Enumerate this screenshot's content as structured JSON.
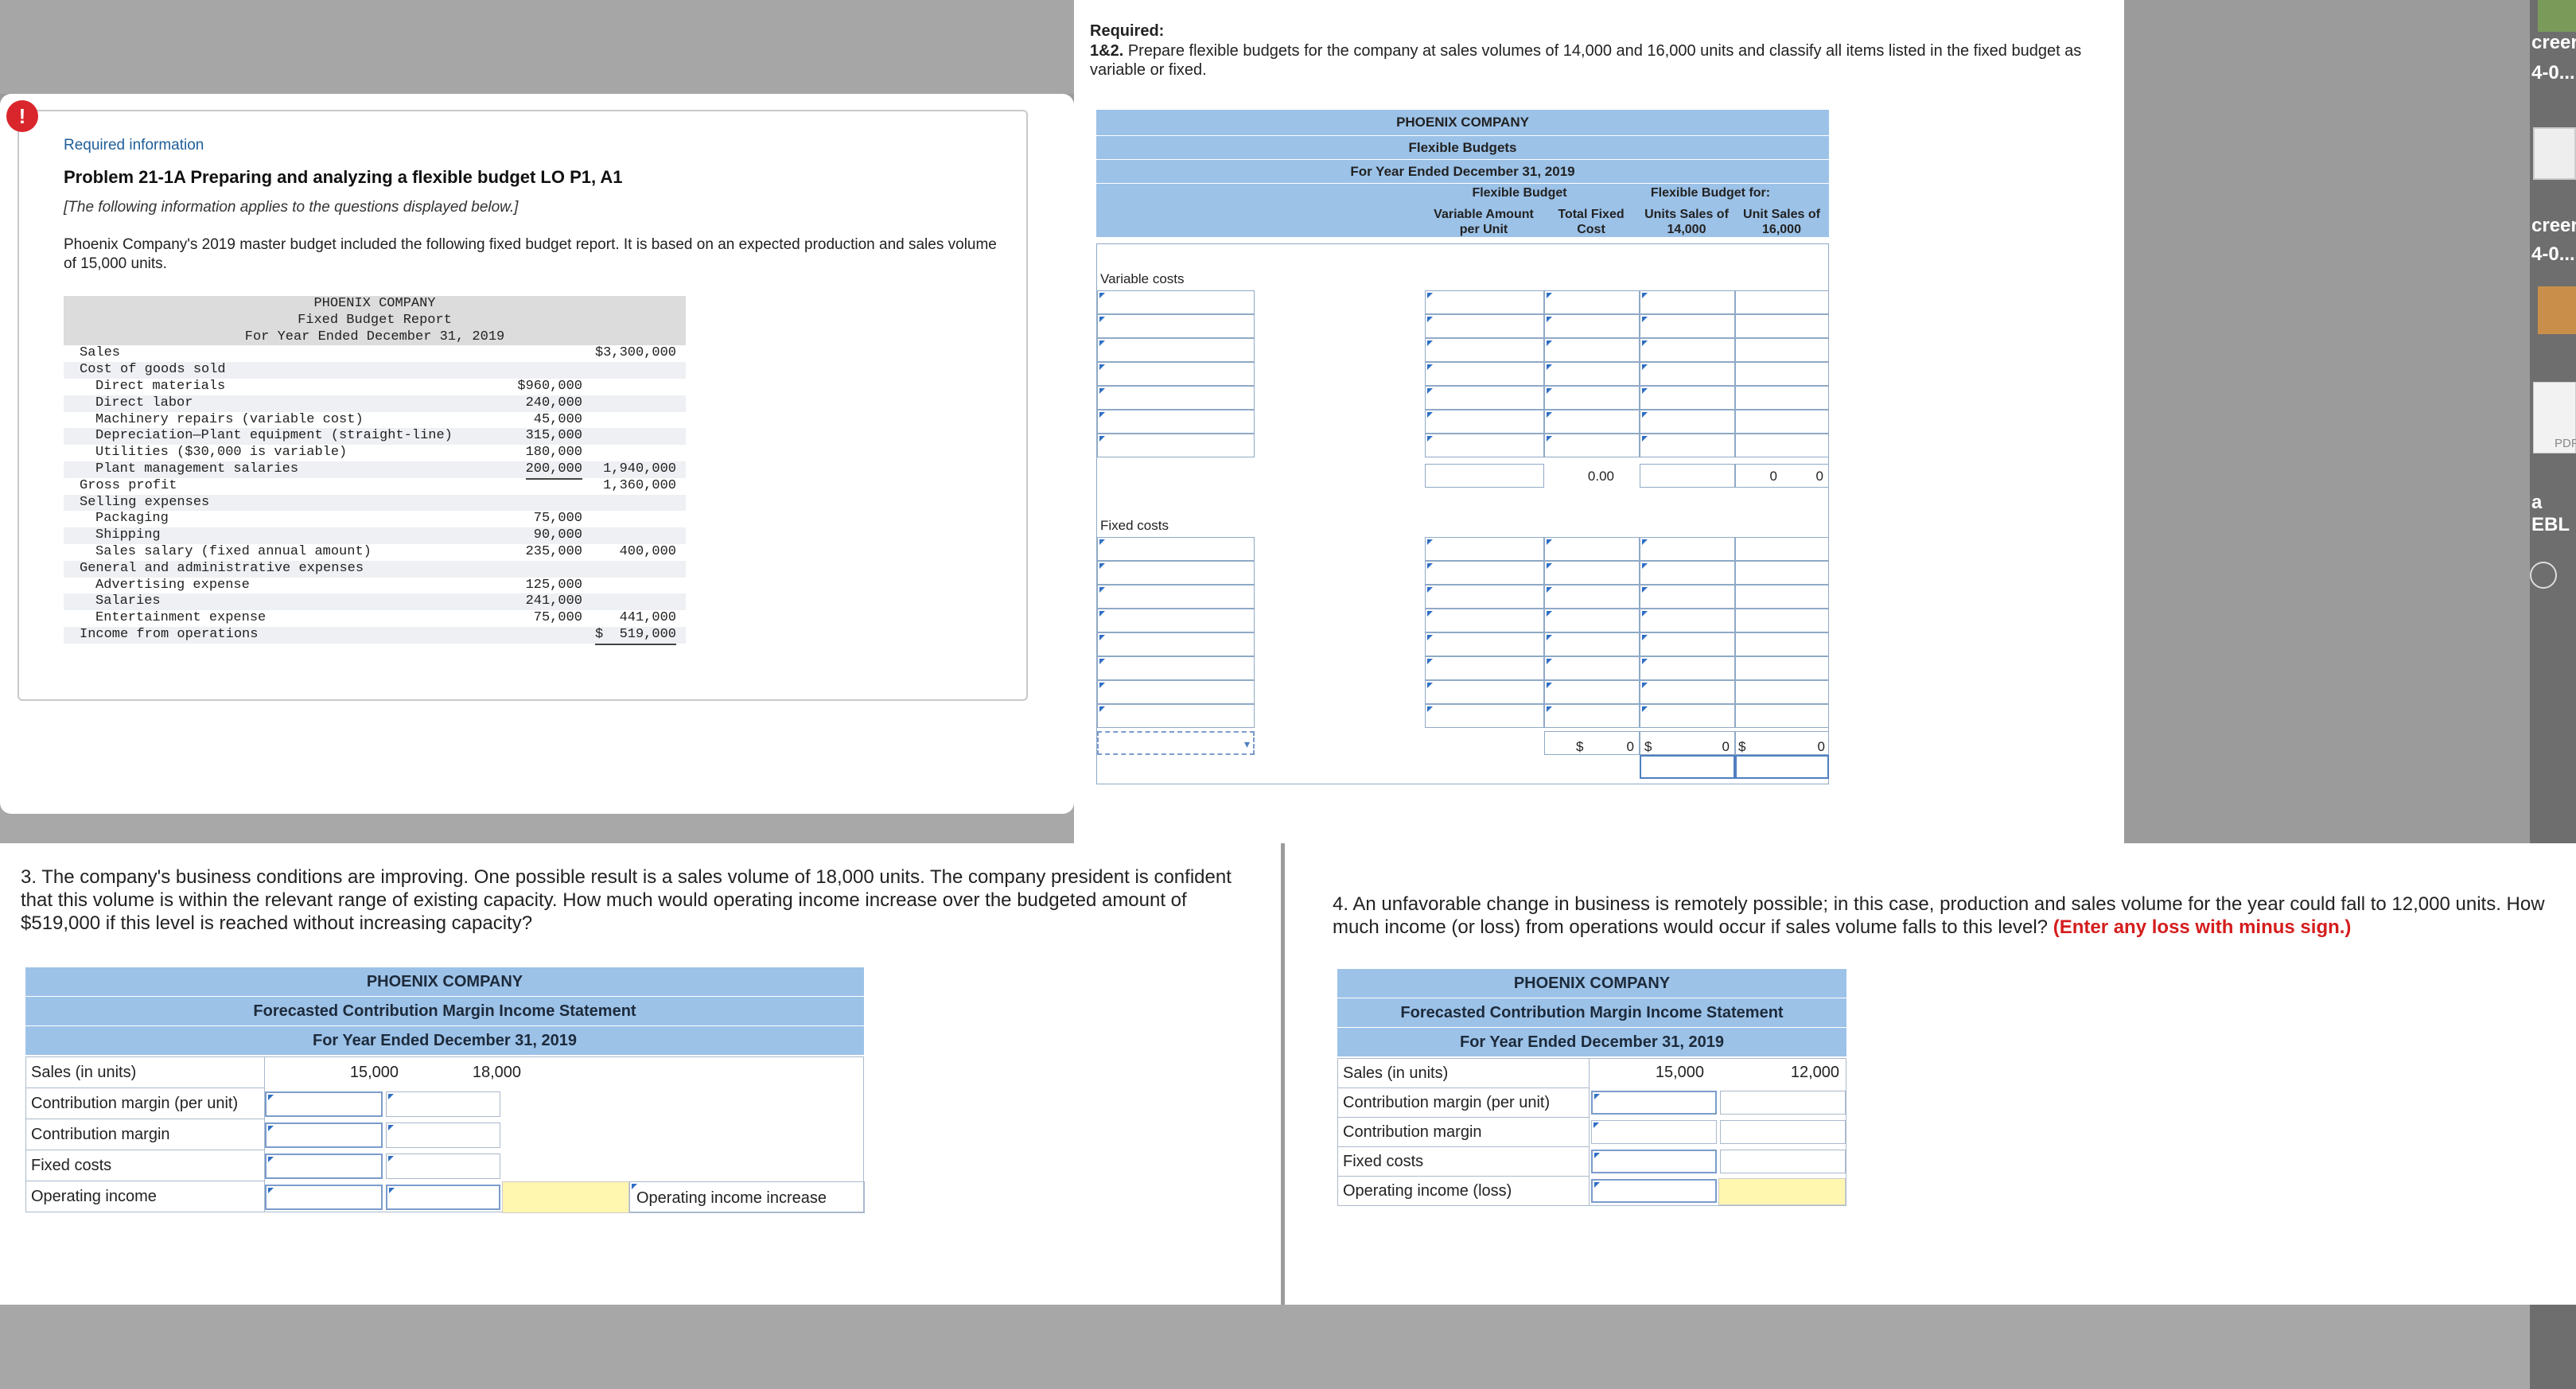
{
  "desktop": {
    "sidebar_labels": [
      "creer",
      "4-0...",
      "creer",
      "4-0...",
      "PDF",
      "a EBL"
    ]
  },
  "required_info": {
    "badge": "!",
    "label": "Required information",
    "title": "Problem 21-1A Preparing and analyzing a flexible budget LO P1, A1",
    "note": "[The following information applies to the questions displayed below.]",
    "intro": "Phoenix Company's 2019 master budget included the following fixed budget report. It is based on an expected production and sales volume of 15,000 units.",
    "report": {
      "company": "PHOENIX COMPANY",
      "name": "Fixed Budget Report",
      "period": "For Year Ended December 31, 2019",
      "rows": [
        {
          "label": "Sales",
          "indent": 0,
          "c1": "",
          "c2": "$3,300,000"
        },
        {
          "label": "Cost of goods sold",
          "indent": 0,
          "c1": "",
          "c2": ""
        },
        {
          "label": "Direct materials",
          "indent": 1,
          "c1": "$960,000",
          "c2": ""
        },
        {
          "label": "Direct labor",
          "indent": 1,
          "c1": "240,000",
          "c2": ""
        },
        {
          "label": "Machinery repairs (variable cost)",
          "indent": 1,
          "c1": "45,000",
          "c2": ""
        },
        {
          "label": "Depreciation—Plant equipment (straight-line)",
          "indent": 1,
          "c1": "315,000",
          "c2": ""
        },
        {
          "label": "Utilities ($30,000 is variable)",
          "indent": 1,
          "c1": "180,000",
          "c2": ""
        },
        {
          "label": "Plant management salaries",
          "indent": 1,
          "c1": "200,000",
          "c2": "1,940,000"
        },
        {
          "label": "Gross profit",
          "indent": 0,
          "c1": "",
          "c2": "1,360,000"
        },
        {
          "label": "Selling expenses",
          "indent": 0,
          "c1": "",
          "c2": ""
        },
        {
          "label": "Packaging",
          "indent": 1,
          "c1": "75,000",
          "c2": ""
        },
        {
          "label": "Shipping",
          "indent": 1,
          "c1": "90,000",
          "c2": ""
        },
        {
          "label": "Sales salary (fixed annual amount)",
          "indent": 1,
          "c1": "235,000",
          "c2": "400,000"
        },
        {
          "label": "General and administrative expenses",
          "indent": 0,
          "c1": "",
          "c2": ""
        },
        {
          "label": "Advertising expense",
          "indent": 1,
          "c1": "125,000",
          "c2": ""
        },
        {
          "label": "Salaries",
          "indent": 1,
          "c1": "241,000",
          "c2": ""
        },
        {
          "label": "Entertainment expense",
          "indent": 1,
          "c1": "75,000",
          "c2": "441,000"
        },
        {
          "label": "Income from operations",
          "indent": 0,
          "c1": "",
          "c2": "$  519,000"
        }
      ]
    }
  },
  "flex": {
    "required_label": "Required:",
    "required_num": "1&2.",
    "required_text": "Prepare flexible budgets for the company at sales volumes of 14,000 and 16,000 units and classify all items listed in the fixed budget as variable or fixed.",
    "company": "PHOENIX COMPANY",
    "title": "Flexible Budgets",
    "period": "For Year Ended December 31, 2019",
    "group1": "Flexible Budget",
    "group2": "Flexible Budget for:",
    "col_var": "Variable Amount per Unit",
    "col_fixed": "Total Fixed Cost",
    "col_14": "Units Sales of 14,000",
    "col_16": "Unit Sales of 16,000",
    "variable_costs": "Variable costs",
    "fixed_costs": "Fixed costs",
    "var_total": "0.00",
    "var_total_14": "0",
    "var_total_16": "0",
    "dollar": "$",
    "fixed_total_fixed": "0",
    "fixed_total_14": "0",
    "fixed_total_16": "0"
  },
  "q3": {
    "text": "3. The company's business conditions are improving. One possible result is a sales volume of 18,000 units. The company president is confident that this volume is within the relevant range of existing capacity. How much would operating income increase over the budgeted amount of $519,000 if this level is reached without increasing capacity?",
    "company": "PHOENIX COMPANY",
    "title": "Forecasted Contribution Margin Income Statement",
    "period": "For Year Ended December 31, 2019",
    "rows": [
      "Sales (in units)",
      "Contribution margin (per unit)",
      "Contribution margin",
      "Fixed costs",
      "Operating income"
    ],
    "units_a": "15,000",
    "units_b": "18,000",
    "increase_label": "Operating income increase"
  },
  "q4": {
    "text_a": "4. An unfavorable change in business is remotely possible; in this case, production and sales volume for the year could fall to 12,000 units. How much income (or loss) from operations would occur if sales volume falls to this level?",
    "text_b": "(Enter any loss with minus sign.)",
    "company": "PHOENIX COMPANY",
    "title": "Forecasted Contribution Margin Income Statement",
    "period": "For Year Ended December 31, 2019",
    "rows": [
      "Sales (in units)",
      "Contribution margin (per unit)",
      "Contribution margin",
      "Fixed costs",
      "Operating income (loss)"
    ],
    "units_a": "15,000",
    "units_b": "12,000"
  }
}
